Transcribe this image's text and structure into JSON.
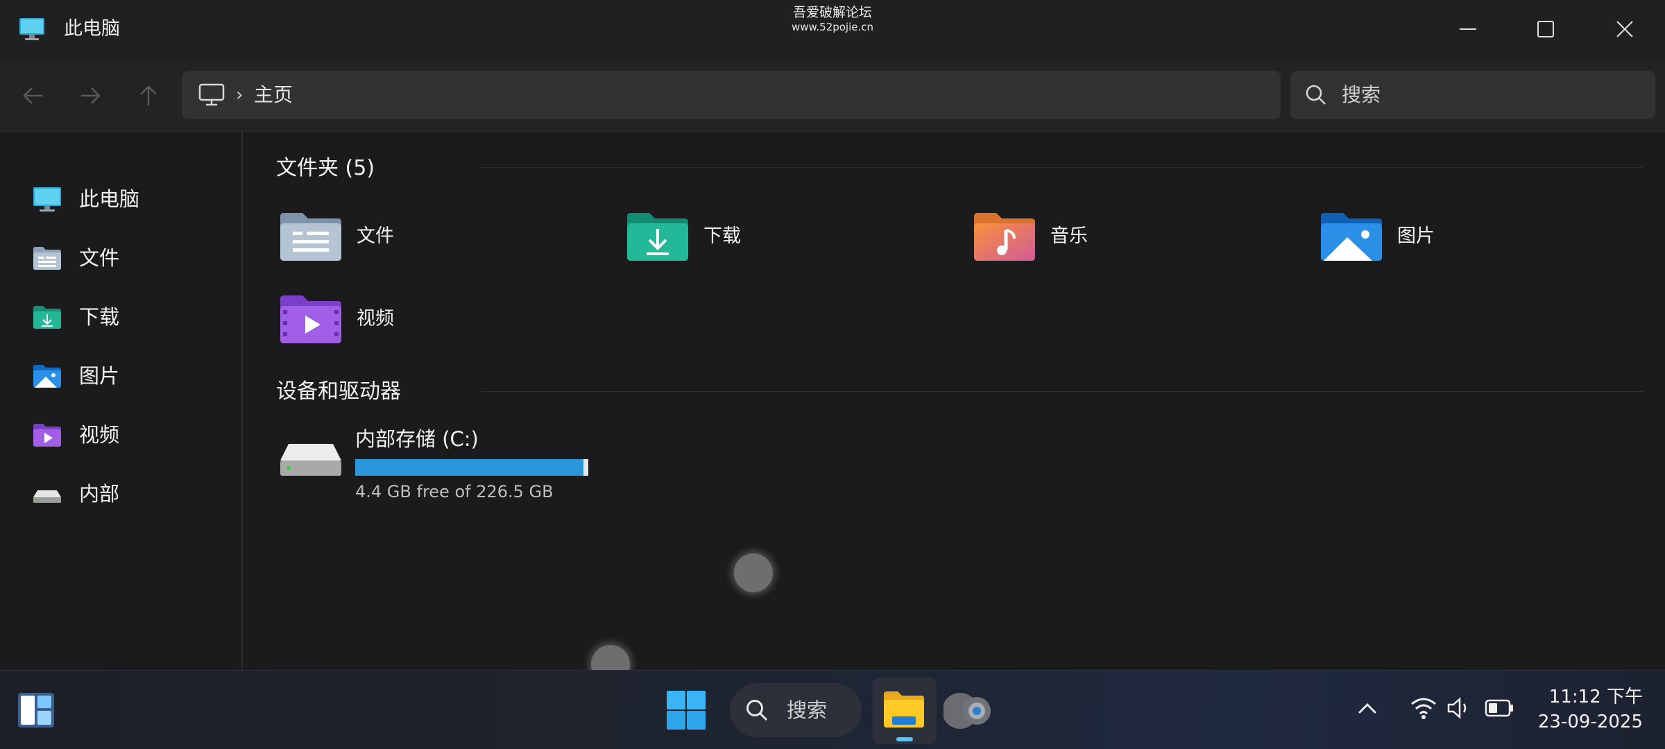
{
  "window": {
    "title": "此电脑",
    "watermark_line1": "吾爱破解论坛",
    "watermark_line2": "www.52pojie.cn"
  },
  "nav": {
    "path": "主页",
    "separator": "›",
    "search_placeholder": "搜索"
  },
  "sidebar": {
    "items": [
      {
        "label": "此电脑",
        "icon": "computer-icon"
      },
      {
        "label": "文件",
        "icon": "documents-folder-icon"
      },
      {
        "label": "下载",
        "icon": "downloads-folder-icon"
      },
      {
        "label": "图片",
        "icon": "pictures-folder-icon"
      },
      {
        "label": "视频",
        "icon": "videos-folder-icon"
      },
      {
        "label": "内部",
        "icon": "drive-icon"
      }
    ]
  },
  "main": {
    "folders_title": "文件夹 (5)",
    "folders": [
      {
        "label": "文件",
        "icon": "documents-folder-icon"
      },
      {
        "label": "下载",
        "icon": "downloads-folder-icon"
      },
      {
        "label": "音乐",
        "icon": "music-folder-icon"
      },
      {
        "label": "图片",
        "icon": "pictures-folder-icon"
      },
      {
        "label": "视频",
        "icon": "videos-folder-icon"
      }
    ],
    "devices_title": "设备和驱动器",
    "drive": {
      "name": "内部存储 (C:)",
      "free_text": "4.4 GB free of 226.5 GB",
      "used_fraction": 0.98
    }
  },
  "taskbar": {
    "search_label": "搜索",
    "time": "11:12 下午",
    "date": "23-09-2025"
  },
  "colors": {
    "accent": "#2b96d9",
    "background": "#1b1b1d"
  }
}
